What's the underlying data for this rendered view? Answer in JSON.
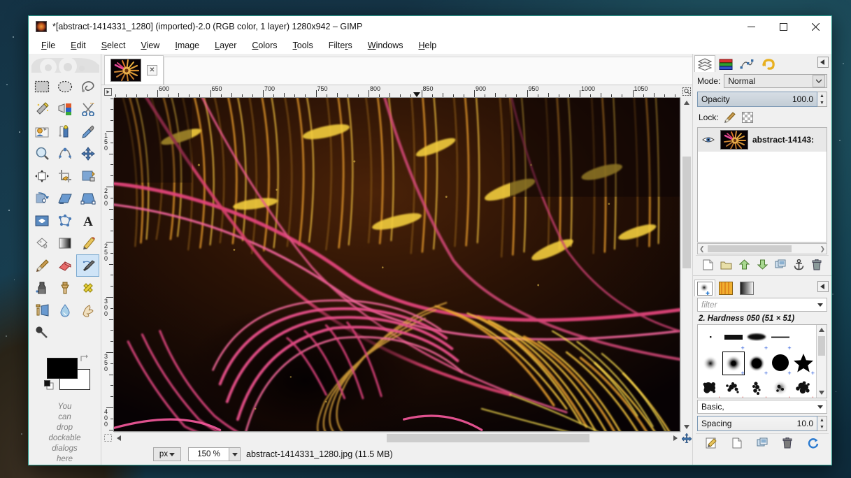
{
  "window": {
    "title": "*[abstract-1414331_1280] (imported)-2.0 (RGB color, 1 layer) 1280x942 – GIMP",
    "minimize_label": "Minimize",
    "maximize_label": "Maximize",
    "close_label": "Close",
    "border_color": "#2a9d8f"
  },
  "menubar": {
    "items": [
      {
        "label": "File",
        "mnemonic": "F"
      },
      {
        "label": "Edit",
        "mnemonic": "E"
      },
      {
        "label": "Select",
        "mnemonic": "S"
      },
      {
        "label": "View",
        "mnemonic": "V"
      },
      {
        "label": "Image",
        "mnemonic": "I"
      },
      {
        "label": "Layer",
        "mnemonic": "L"
      },
      {
        "label": "Colors",
        "mnemonic": "C"
      },
      {
        "label": "Tools",
        "mnemonic": "T"
      },
      {
        "label": "Filters",
        "mnemonic": "r"
      },
      {
        "label": "Windows",
        "mnemonic": "W"
      },
      {
        "label": "Help",
        "mnemonic": "H"
      }
    ]
  },
  "toolbox": {
    "tools": [
      {
        "name": "rect-select-tool",
        "label": "Rectangle Select",
        "selected": false
      },
      {
        "name": "ellipse-select-tool",
        "label": "Ellipse Select",
        "selected": false
      },
      {
        "name": "free-select-tool",
        "label": "Free Select",
        "selected": false
      },
      {
        "name": "fuzzy-select-tool",
        "label": "Fuzzy Select",
        "selected": false
      },
      {
        "name": "select-by-color-tool",
        "label": "Select by Color",
        "selected": false
      },
      {
        "name": "scissors-select-tool",
        "label": "Intelligent Scissors",
        "selected": false
      },
      {
        "name": "foreground-select-tool",
        "label": "Foreground Select",
        "selected": false
      },
      {
        "name": "measure-tool",
        "label": "Measure",
        "selected": false
      },
      {
        "name": "color-picker-tool",
        "label": "Color Picker",
        "selected": false
      },
      {
        "name": "zoom-tool",
        "label": "Zoom",
        "selected": false
      },
      {
        "name": "paths-tool",
        "label": "Paths",
        "selected": false
      },
      {
        "name": "move-tool",
        "label": "Move",
        "selected": false
      },
      {
        "name": "align-tool",
        "label": "Alignment",
        "selected": false
      },
      {
        "name": "crop-tool",
        "label": "Crop",
        "selected": false
      },
      {
        "name": "transform-tool",
        "label": "Unified Transform",
        "selected": false
      },
      {
        "name": "rotate-tool",
        "label": "Rotate",
        "selected": false
      },
      {
        "name": "shear-tool",
        "label": "Shear",
        "selected": false
      },
      {
        "name": "perspective-tool",
        "label": "Perspective",
        "selected": false
      },
      {
        "name": "flip-tool",
        "label": "Flip",
        "selected": false
      },
      {
        "name": "cage-transform-tool",
        "label": "Cage Transform",
        "selected": false
      },
      {
        "name": "text-tool",
        "label": "Text",
        "selected": false
      },
      {
        "name": "bucket-fill-tool",
        "label": "Bucket Fill",
        "selected": false
      },
      {
        "name": "gradient-tool",
        "label": "Gradient",
        "selected": false
      },
      {
        "name": "pencil-tool",
        "label": "Pencil",
        "selected": false
      },
      {
        "name": "paintbrush-tool",
        "label": "Paintbrush",
        "selected": false
      },
      {
        "name": "eraser-tool",
        "label": "Eraser",
        "selected": false
      },
      {
        "name": "airbrush-tool",
        "label": "Airbrush",
        "selected": true
      },
      {
        "name": "ink-tool",
        "label": "Ink",
        "selected": false
      },
      {
        "name": "clone-tool",
        "label": "Clone",
        "selected": false
      },
      {
        "name": "heal-tool",
        "label": "Heal",
        "selected": false
      },
      {
        "name": "perspective-clone-tool",
        "label": "Perspective Clone",
        "selected": false
      },
      {
        "name": "blur-sharpen-tool",
        "label": "Blur / Sharpen",
        "selected": false
      },
      {
        "name": "smudge-tool",
        "label": "Smudge",
        "selected": false
      },
      {
        "name": "dodge-burn-tool",
        "label": "Dodge / Burn",
        "selected": false
      }
    ],
    "colors": {
      "foreground": "#000000",
      "background": "#ffffff",
      "swap_label": "Swap colors",
      "reset_label": "Reset colors"
    },
    "drop_hint_lines": [
      "You",
      "can",
      "drop",
      "dockable",
      "dialogs",
      "here"
    ]
  },
  "image_tab": {
    "close_label": "✕",
    "thumbnail_alt": "abstract fractal thumbnail"
  },
  "rulers": {
    "unit": "px",
    "horizontal_labels": [
      "600",
      "650",
      "700",
      "750",
      "800",
      "850",
      "900",
      "950",
      "1000",
      "1050"
    ],
    "vertical_labels": [
      "150",
      "200",
      "250",
      "300",
      "350",
      "400"
    ],
    "pointer_position": "860"
  },
  "statusbar": {
    "unit": "px",
    "zoom": "150 %",
    "message": "abstract-1414331_1280.jpg (11.5 MB)"
  },
  "dock": {
    "tabs": [
      {
        "name": "layers-tab",
        "label": "Layers",
        "active": true
      },
      {
        "name": "channels-tab",
        "label": "Channels",
        "active": false
      },
      {
        "name": "paths-tab",
        "label": "Paths",
        "active": false
      },
      {
        "name": "undo-history-tab",
        "label": "Undo History",
        "active": false
      }
    ],
    "layers": {
      "mode_label": "Mode:",
      "mode_value": "Normal",
      "opacity_label": "Opacity",
      "opacity_value": "100.0",
      "lock_label": "Lock:",
      "lock_pixels_label": "Lock pixels",
      "lock_alpha_label": "Lock alpha channel",
      "items": [
        {
          "name": "abstract-14143:",
          "visible": true
        }
      ],
      "toolbar": [
        {
          "name": "new-layer-button",
          "label": "Create a new layer"
        },
        {
          "name": "new-layer-group-button",
          "label": "Create a new layer group"
        },
        {
          "name": "raise-layer-button",
          "label": "Raise this layer"
        },
        {
          "name": "lower-layer-button",
          "label": "Lower this layer"
        },
        {
          "name": "duplicate-layer-button",
          "label": "Duplicate this layer"
        },
        {
          "name": "anchor-layer-button",
          "label": "Anchor the floating layer"
        },
        {
          "name": "delete-layer-button",
          "label": "Delete this layer"
        }
      ]
    },
    "brushes": {
      "tabs": [
        {
          "name": "brushes-tab",
          "label": "Brushes",
          "active": true
        },
        {
          "name": "patterns-tab",
          "label": "Patterns",
          "active": false
        },
        {
          "name": "gradients-tab",
          "label": "Gradients",
          "active": false
        }
      ],
      "filter_placeholder": "filter",
      "selected_brush": "2. Hardness 050 (51 × 51)",
      "tag_value": "Basic,",
      "spacing_label": "Spacing",
      "spacing_value": "10.0",
      "grid": [
        {
          "name": "brush-dot",
          "kind": "dot",
          "selected": false
        },
        {
          "name": "brush-block-01",
          "kind": "block",
          "selected": false
        },
        {
          "name": "brush-ellipse-soft",
          "kind": "ellipse",
          "selected": false
        },
        {
          "name": "brush-line-01",
          "kind": "line",
          "selected": false
        },
        {
          "name": "brush-empty-01",
          "kind": "empty",
          "selected": false
        },
        {
          "name": "brush-hardness-025",
          "kind": "soft",
          "selected": false
        },
        {
          "name": "brush-hardness-050",
          "kind": "soft",
          "selected": true
        },
        {
          "name": "brush-hardness-075",
          "kind": "medium",
          "selected": false
        },
        {
          "name": "brush-hardness-100",
          "kind": "hard",
          "selected": false
        },
        {
          "name": "brush-star",
          "kind": "star",
          "selected": false
        },
        {
          "name": "brush-acrylic-01",
          "kind": "splatter",
          "selected": false
        },
        {
          "name": "brush-acrylic-02",
          "kind": "splatter",
          "selected": false
        },
        {
          "name": "brush-acrylic-03",
          "kind": "splatter",
          "selected": false
        },
        {
          "name": "brush-acrylic-04",
          "kind": "splatter",
          "selected": false
        },
        {
          "name": "brush-acrylic-05",
          "kind": "splatter",
          "selected": false
        }
      ],
      "toolbar": [
        {
          "name": "edit-brush-button",
          "label": "Edit this brush"
        },
        {
          "name": "new-brush-button",
          "label": "Create a new brush"
        },
        {
          "name": "duplicate-brush-button",
          "label": "Duplicate this brush"
        },
        {
          "name": "delete-brush-button",
          "label": "Delete this brush"
        },
        {
          "name": "refresh-brushes-button",
          "label": "Refresh brushes"
        }
      ]
    }
  }
}
